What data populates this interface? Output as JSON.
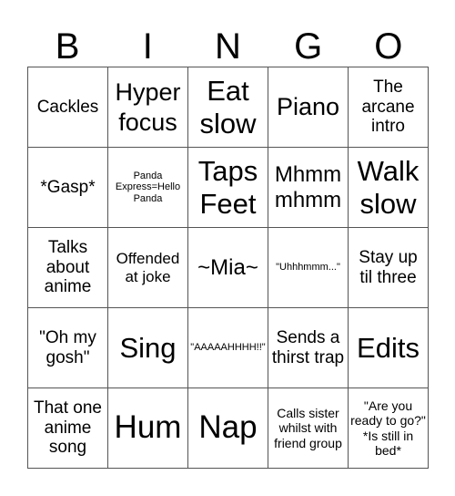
{
  "header": {
    "letters": [
      "B",
      "I",
      "N",
      "G",
      "O"
    ]
  },
  "board": {
    "rows": [
      [
        "Cackles",
        "Hyper focus",
        "Eat slow",
        "Piano",
        "The arcane intro"
      ],
      [
        "*Gasp*",
        "Panda Express=Hello Panda",
        "Taps Feet",
        "Mhmm mhmm",
        "Walk slow"
      ],
      [
        "Talks about anime",
        "Offended at joke",
        "~Mia~",
        "\"Uhhhmmm...\"",
        "Stay up til three"
      ],
      [
        "\"Oh my gosh\"",
        "Sing",
        "\"AAAAAHHHH!!\"",
        "Sends a thirst trap",
        "Edits"
      ],
      [
        "That one anime song",
        "Hum",
        "Nap",
        "Calls sister whilst with friend group",
        "\"Are you ready to go?\" *Is still in bed*"
      ]
    ]
  }
}
